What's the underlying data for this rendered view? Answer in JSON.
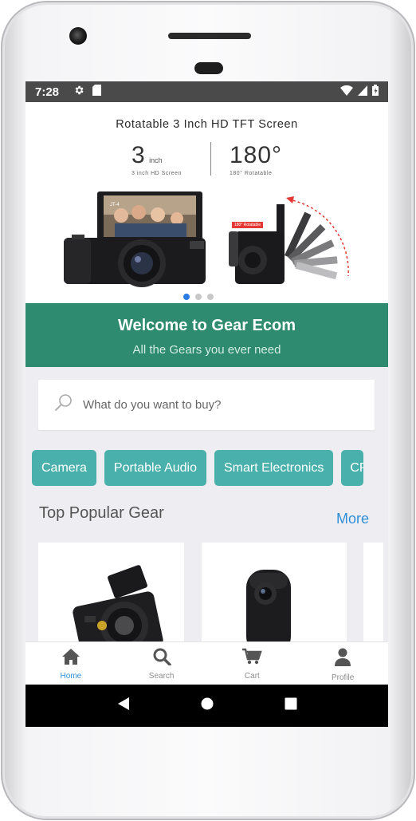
{
  "status_bar": {
    "time": "7:28"
  },
  "banner": {
    "headline": "Rotatable 3 Inch HD TFT Screen",
    "spec_left_big": "3",
    "spec_left_unit": "inch",
    "spec_left_small": "3 inch HD Screen",
    "spec_right_big": "180°",
    "spec_right_small": "180°  Rotatable",
    "inset_tag": "180° Rotatable",
    "camera_badge": "JT-4",
    "active_slide": 1,
    "slide_count": 3
  },
  "welcome": {
    "title": "Welcome to Gear Ecom",
    "subtitle": "All the Gears you ever need"
  },
  "search": {
    "placeholder": "What do you want to buy?",
    "value": ""
  },
  "categories": [
    "Camera",
    "Portable Audio",
    "Smart Electronics",
    "CP"
  ],
  "popular": {
    "title": "Top Popular Gear",
    "more_label": "More"
  },
  "tabs": [
    {
      "label": "Home",
      "icon": "home-icon",
      "active": true
    },
    {
      "label": "Search",
      "icon": "search-icon",
      "active": false
    },
    {
      "label": "Cart",
      "icon": "cart-icon",
      "active": false
    },
    {
      "label": "Profile",
      "icon": "profile-icon",
      "active": false
    }
  ],
  "colors": {
    "accent_green": "#2e8b6f",
    "chip_teal": "#4ab0ac",
    "link_blue": "#2f8fd8",
    "status_bar": "#4a4a4a"
  }
}
